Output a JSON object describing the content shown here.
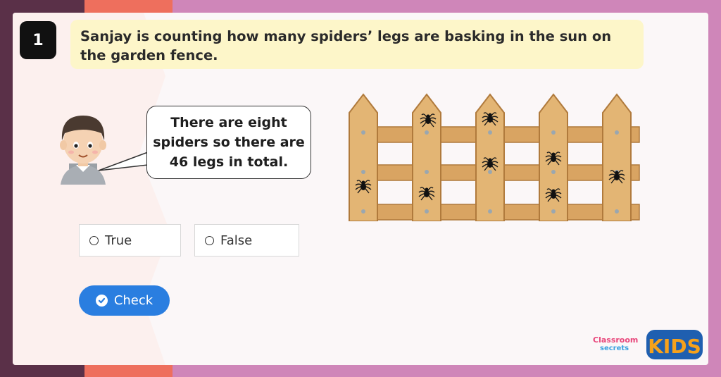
{
  "question": {
    "number": "1",
    "text": "Sanjay is counting how many spiders’ legs are basking in the sun on the garden fence."
  },
  "speech": {
    "text": "There are eight spiders so there are 46 legs in total."
  },
  "options": [
    {
      "label": "True"
    },
    {
      "label": "False"
    }
  ],
  "check": {
    "label": "Check",
    "icon": "check-circle-icon"
  },
  "fence": {
    "spider_count": 8
  },
  "logo": {
    "line1": "Classroom",
    "line2": "secrets",
    "brand": "KIDS"
  },
  "colors": {
    "accent": "#2a7ee0",
    "question_bg": "#fdf6c9",
    "background": "#cf86b9",
    "fence_wood": "#e3b574"
  }
}
